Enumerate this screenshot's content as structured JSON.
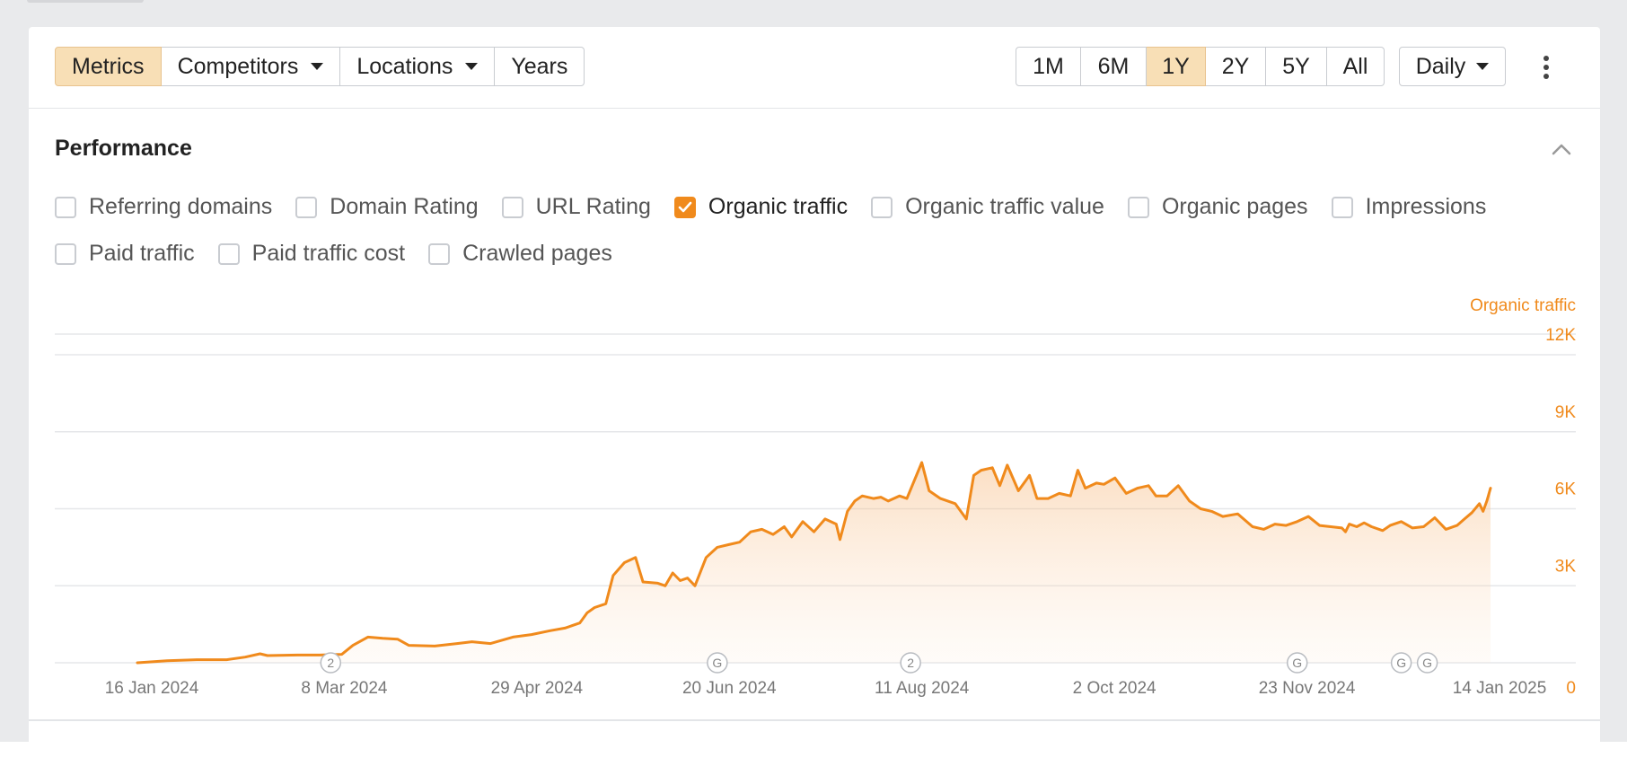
{
  "toolbar": {
    "left_buttons": [
      {
        "label": "Metrics",
        "active": true,
        "dropdown": false
      },
      {
        "label": "Competitors",
        "active": false,
        "dropdown": true
      },
      {
        "label": "Locations",
        "active": false,
        "dropdown": true
      },
      {
        "label": "Years",
        "active": false,
        "dropdown": false
      }
    ],
    "ranges": [
      {
        "label": "1M",
        "active": false
      },
      {
        "label": "6M",
        "active": false
      },
      {
        "label": "1Y",
        "active": true
      },
      {
        "label": "2Y",
        "active": false
      },
      {
        "label": "5Y",
        "active": false
      },
      {
        "label": "All",
        "active": false
      }
    ],
    "granularity": "Daily",
    "more_icon": "vertical-dots-icon"
  },
  "section": {
    "title": "Performance",
    "collapse_icon": "chevron-up-icon",
    "metrics_row1": [
      {
        "label": "Referring domains",
        "checked": false
      },
      {
        "label": "Domain Rating",
        "checked": false
      },
      {
        "label": "URL Rating",
        "checked": false
      },
      {
        "label": "Organic traffic",
        "checked": true
      },
      {
        "label": "Organic traffic value",
        "checked": false
      },
      {
        "label": "Organic pages",
        "checked": false
      },
      {
        "label": "Impressions",
        "checked": false
      }
    ],
    "metrics_row2": [
      {
        "label": "Paid traffic",
        "checked": false
      },
      {
        "label": "Paid traffic cost",
        "checked": false
      },
      {
        "label": "Crawled pages",
        "checked": false
      }
    ]
  },
  "colors": {
    "accent": "#f08a1c",
    "active_button": "#f8dfb6",
    "grid": "#e6e7ea",
    "tick_text": "#777777"
  },
  "chart_data": {
    "type": "area",
    "series": [
      {
        "name": "Organic traffic"
      }
    ],
    "y_tick_labels": [
      "0",
      "3K",
      "6K",
      "9K",
      "12K"
    ],
    "ylim": [
      0,
      12000
    ],
    "x_tick_labels": [
      "16 Jan 2024",
      "8 Mar 2024",
      "29 Apr 2024",
      "20 Jun 2024",
      "11 Aug 2024",
      "2 Oct 2024",
      "23 Nov 2024",
      "14 Jan 2025"
    ],
    "x_range": [
      "2024-01-16",
      "2025-01-14"
    ],
    "points": [
      [
        "2024-01-16",
        0
      ],
      [
        "2024-01-24",
        80
      ],
      [
        "2024-02-01",
        120
      ],
      [
        "2024-02-09",
        120
      ],
      [
        "2024-02-14",
        220
      ],
      [
        "2024-02-18",
        350
      ],
      [
        "2024-02-20",
        280
      ],
      [
        "2024-02-28",
        300
      ],
      [
        "2024-03-05",
        300
      ],
      [
        "2024-03-11",
        330
      ],
      [
        "2024-03-14",
        680
      ],
      [
        "2024-03-18",
        1000
      ],
      [
        "2024-03-22",
        950
      ],
      [
        "2024-03-26",
        920
      ],
      [
        "2024-03-29",
        680
      ],
      [
        "2024-04-05",
        650
      ],
      [
        "2024-04-11",
        750
      ],
      [
        "2024-04-15",
        820
      ],
      [
        "2024-04-20",
        750
      ],
      [
        "2024-04-26",
        1000
      ],
      [
        "2024-05-01",
        1100
      ],
      [
        "2024-05-06",
        1250
      ],
      [
        "2024-05-10",
        1350
      ],
      [
        "2024-05-14",
        1550
      ],
      [
        "2024-05-16",
        1950
      ],
      [
        "2024-05-18",
        2150
      ],
      [
        "2024-05-21",
        2300
      ],
      [
        "2024-05-23",
        3400
      ],
      [
        "2024-05-26",
        3900
      ],
      [
        "2024-05-29",
        4100
      ],
      [
        "2024-05-31",
        3150
      ],
      [
        "2024-06-04",
        3100
      ],
      [
        "2024-06-06",
        3000
      ],
      [
        "2024-06-08",
        3500
      ],
      [
        "2024-06-10",
        3200
      ],
      [
        "2024-06-12",
        3300
      ],
      [
        "2024-06-14",
        3000
      ],
      [
        "2024-06-17",
        4100
      ],
      [
        "2024-06-20",
        4500
      ],
      [
        "2024-06-23",
        4600
      ],
      [
        "2024-06-26",
        4700
      ],
      [
        "2024-06-29",
        5100
      ],
      [
        "2024-07-02",
        5200
      ],
      [
        "2024-07-05",
        5000
      ],
      [
        "2024-07-08",
        5300
      ],
      [
        "2024-07-10",
        4900
      ],
      [
        "2024-07-13",
        5500
      ],
      [
        "2024-07-16",
        5100
      ],
      [
        "2024-07-19",
        5600
      ],
      [
        "2024-07-22",
        5400
      ],
      [
        "2024-07-23",
        4800
      ],
      [
        "2024-07-25",
        5900
      ],
      [
        "2024-07-27",
        6300
      ],
      [
        "2024-07-29",
        6500
      ],
      [
        "2024-08-01",
        6400
      ],
      [
        "2024-08-03",
        6450
      ],
      [
        "2024-08-05",
        6300
      ],
      [
        "2024-08-08",
        6500
      ],
      [
        "2024-08-10",
        6400
      ],
      [
        "2024-08-14",
        7800
      ],
      [
        "2024-08-16",
        6700
      ],
      [
        "2024-08-19",
        6400
      ],
      [
        "2024-08-23",
        6200
      ],
      [
        "2024-08-26",
        5600
      ],
      [
        "2024-08-28",
        7300
      ],
      [
        "2024-08-30",
        7500
      ],
      [
        "2024-09-02",
        7600
      ],
      [
        "2024-09-04",
        6900
      ],
      [
        "2024-09-06",
        7700
      ],
      [
        "2024-09-09",
        6700
      ],
      [
        "2024-09-12",
        7300
      ],
      [
        "2024-09-14",
        6400
      ],
      [
        "2024-09-17",
        6400
      ],
      [
        "2024-09-20",
        6600
      ],
      [
        "2024-09-23",
        6500
      ],
      [
        "2024-09-25",
        7500
      ],
      [
        "2024-09-27",
        6800
      ],
      [
        "2024-09-30",
        7000
      ],
      [
        "2024-10-02",
        6950
      ],
      [
        "2024-10-05",
        7200
      ],
      [
        "2024-10-08",
        6600
      ],
      [
        "2024-10-11",
        6800
      ],
      [
        "2024-10-14",
        6900
      ],
      [
        "2024-10-16",
        6500
      ],
      [
        "2024-10-19",
        6500
      ],
      [
        "2024-10-22",
        6900
      ],
      [
        "2024-10-25",
        6300
      ],
      [
        "2024-10-28",
        6000
      ],
      [
        "2024-10-31",
        5900
      ],
      [
        "2024-11-03",
        5700
      ],
      [
        "2024-11-07",
        5800
      ],
      [
        "2024-11-11",
        5300
      ],
      [
        "2024-11-14",
        5200
      ],
      [
        "2024-11-17",
        5400
      ],
      [
        "2024-11-20",
        5350
      ],
      [
        "2024-11-23",
        5500
      ],
      [
        "2024-11-26",
        5700
      ],
      [
        "2024-11-29",
        5350
      ],
      [
        "2024-12-02",
        5300
      ],
      [
        "2024-12-05",
        5250
      ],
      [
        "2024-12-06",
        5100
      ],
      [
        "2024-12-07",
        5400
      ],
      [
        "2024-12-09",
        5300
      ],
      [
        "2024-12-11",
        5450
      ],
      [
        "2024-12-13",
        5300
      ],
      [
        "2024-12-16",
        5150
      ],
      [
        "2024-12-18",
        5350
      ],
      [
        "2024-12-21",
        5500
      ],
      [
        "2024-12-24",
        5250
      ],
      [
        "2024-12-27",
        5300
      ],
      [
        "2024-12-30",
        5650
      ],
      [
        "2025-01-02",
        5200
      ],
      [
        "2025-01-05",
        5350
      ],
      [
        "2025-01-07",
        5600
      ],
      [
        "2025-01-09",
        5850
      ],
      [
        "2025-01-11",
        6200
      ],
      [
        "2025-01-12",
        5900
      ],
      [
        "2025-01-13",
        6300
      ],
      [
        "2025-01-14",
        6800
      ]
    ],
    "x_annotation_markers": [
      {
        "label": "2",
        "date": "2024-03-08"
      },
      {
        "label": "G",
        "date": "2024-06-20"
      },
      {
        "label": "2",
        "date": "2024-08-11"
      },
      {
        "label": "G",
        "date": "2024-11-23"
      },
      {
        "label": "G",
        "date": "2024-12-21"
      },
      {
        "label": "G",
        "date": "2024-12-28"
      }
    ],
    "axis_title_right": "Organic traffic",
    "grid": true
  }
}
